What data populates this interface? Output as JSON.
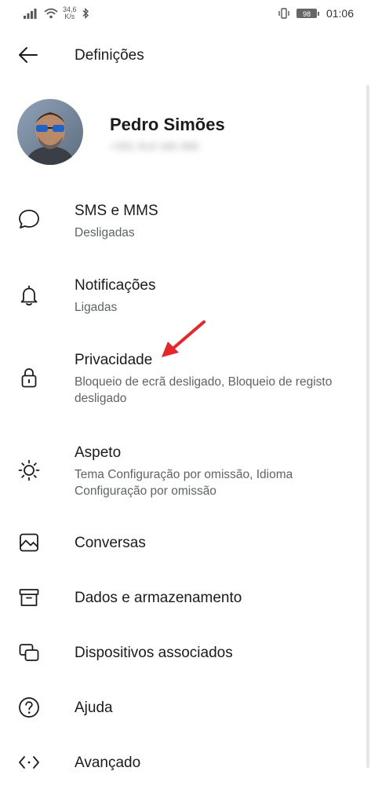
{
  "status_bar": {
    "network_speed_value": "34,6",
    "network_speed_unit": "K/s",
    "battery_level": "98",
    "time": "01:06"
  },
  "header": {
    "title": "Definições"
  },
  "profile": {
    "name": "Pedro Simões",
    "phone": "+351 914 160 460"
  },
  "settings": [
    {
      "icon": "chat-bubble-icon",
      "label": "SMS e MMS",
      "summary": "Desligadas"
    },
    {
      "icon": "bell-icon",
      "label": "Notificações",
      "summary": "Ligadas"
    },
    {
      "icon": "lock-icon",
      "label": "Privacidade",
      "summary": "Bloqueio de ecrã desligado, Bloqueio de registo desligado"
    },
    {
      "icon": "brightness-icon",
      "label": "Aspeto",
      "summary": "Tema Configuração por omissão, Idioma Configuração por omissão"
    },
    {
      "icon": "image-icon",
      "label": "Conversas"
    },
    {
      "icon": "archive-icon",
      "label": "Dados e armazenamento"
    },
    {
      "icon": "linked-devices-icon",
      "label": "Dispositivos associados"
    },
    {
      "icon": "help-icon",
      "label": "Ajuda"
    },
    {
      "icon": "code-icon",
      "label": "Avançado"
    }
  ],
  "colors": {
    "text": "#1b1b1d",
    "secondary_text": "#5f6368",
    "annotation_arrow": "#e8262a"
  }
}
